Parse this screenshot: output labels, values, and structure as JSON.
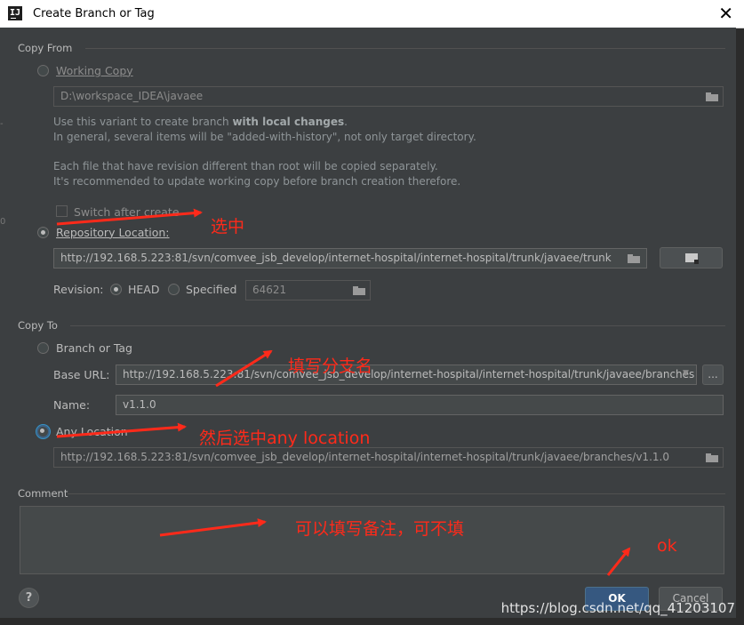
{
  "window": {
    "title": "Create Branch or Tag",
    "app_icon": "IJ",
    "close_glyph": "✕"
  },
  "copy_from": {
    "title": "Copy From",
    "working_copy": {
      "label": "Working Copy",
      "path": "D:\\workspace_IDEA\\javaee",
      "desc_line1_a": "Use this variant to create branch ",
      "desc_line1_b": "with local changes",
      "desc_line1_c": ".",
      "desc_line2": "In general, several items will be \"added-with-history\", not only target directory.",
      "desc_line3": "Each file that have revision different than root will be copied separately.",
      "desc_line4": "It's recommended to update working copy before branch creation therefore.",
      "switch_after_create": "Switch after create"
    },
    "repository": {
      "label": "Repository Location:",
      "url": "http://192.168.5.223:81/svn/comvee_jsb_develop/internet-hospital/internet-hospital/trunk/javaee/trunk",
      "selected": true
    },
    "revision": {
      "label": "Revision:",
      "head": "HEAD",
      "specified": "Specified",
      "value": "64621"
    }
  },
  "copy_to": {
    "title": "Copy To",
    "branch_or_tag": "Branch or Tag",
    "base_url_label": "Base URL:",
    "base_url": "http://192.168.5.223:81/svn/comvee_jsb_develop/internet-hospital/internet-hospital/trunk/javaee/branches",
    "more_button": "...",
    "name_label": "Name:",
    "name_value": "v1.1.0",
    "any_location": "Any Location",
    "any_location_url": "http://192.168.5.223:81/svn/comvee_jsb_develop/internet-hospital/internet-hospital/trunk/javaee/branches/v1.1.0"
  },
  "comment": {
    "title": "Comment",
    "value": ""
  },
  "buttons": {
    "help": "?",
    "ok": "OK",
    "cancel": "Cancel"
  },
  "annotations": {
    "select": "选中",
    "fill_branch": "填写分支名",
    "then_select": "然后选中any location",
    "comment_note": "可以填写备注，可不填",
    "ok": "ok"
  },
  "watermark": "https://blog.csdn.net/qq_41203107",
  "colors": {
    "dialog_bg": "#3c3f41",
    "field_bg": "#45494a",
    "primary": "#365880",
    "annotation": "#ff2a1a"
  }
}
